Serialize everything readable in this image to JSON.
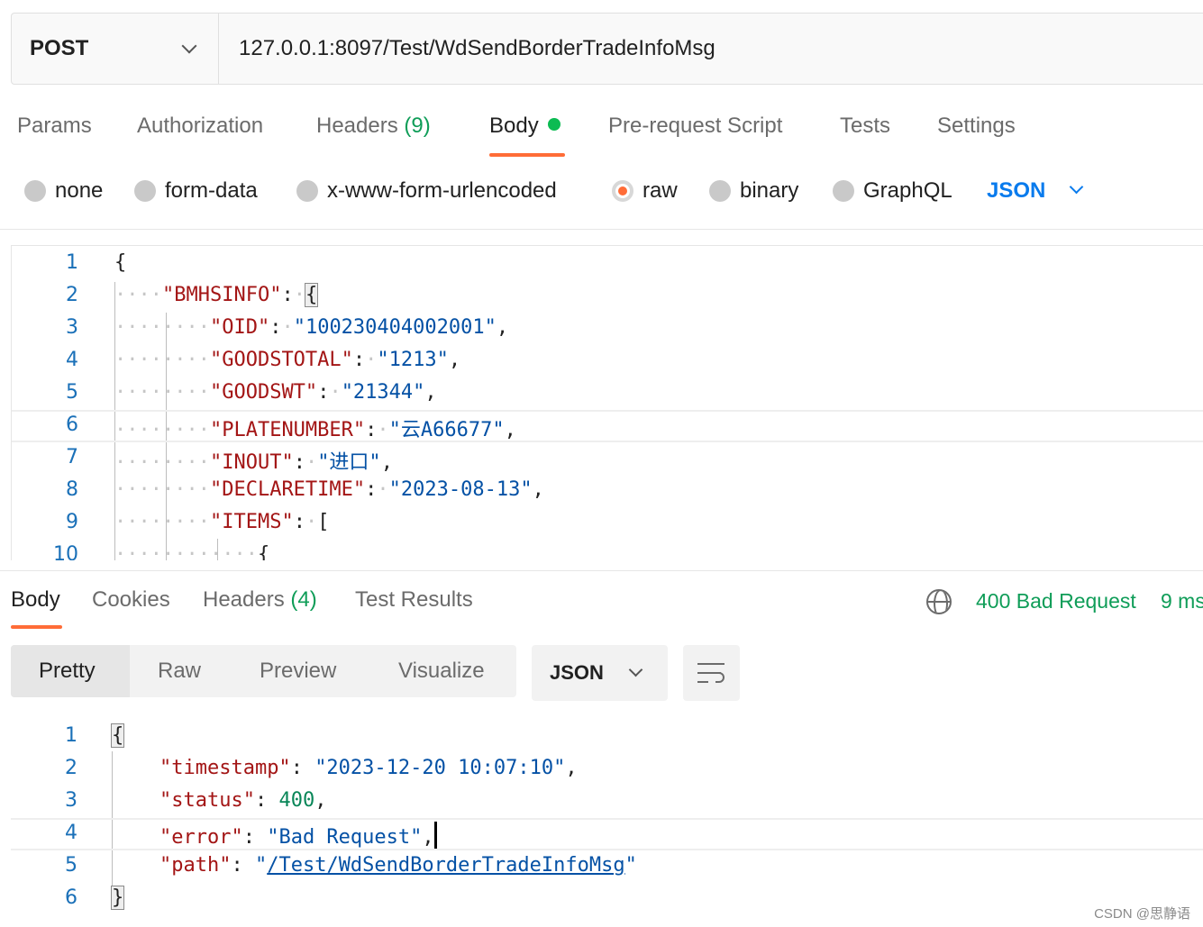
{
  "request": {
    "method": "POST",
    "url": "127.0.0.1:8097/Test/WdSendBorderTradeInfoMsg"
  },
  "request_tabs": [
    {
      "label": "Params"
    },
    {
      "label": "Authorization"
    },
    {
      "label": "Headers",
      "count": "(9)"
    },
    {
      "label": "Body",
      "active": true
    },
    {
      "label": "Pre-request Script"
    },
    {
      "label": "Tests"
    },
    {
      "label": "Settings"
    }
  ],
  "body_types": [
    {
      "label": "none"
    },
    {
      "label": "form-data"
    },
    {
      "label": "x-www-form-urlencoded"
    },
    {
      "label": "raw",
      "selected": true
    },
    {
      "label": "binary"
    },
    {
      "label": "GraphQL"
    }
  ],
  "body_format": "JSON",
  "request_body": {
    "line_numbers": [
      "1",
      "2",
      "3",
      "4",
      "5",
      "6",
      "7",
      "8",
      "9",
      "10"
    ],
    "open_brace": "{",
    "root_key": "\"BMHSINFO\"",
    "fields": [
      {
        "key": "\"OID\"",
        "value": "\"100230404002001\""
      },
      {
        "key": "\"GOODSTOTAL\"",
        "value": "\"1213\""
      },
      {
        "key": "\"GOODSWT\"",
        "value": "\"21344\""
      },
      {
        "key": "\"PLATENUMBER\"",
        "value": "\"云A66677\""
      },
      {
        "key": "\"INOUT\"",
        "value": "\"进口\""
      },
      {
        "key": "\"DECLARETIME\"",
        "value": "\"2023-08-13\""
      }
    ],
    "items_key": "\"ITEMS\"",
    "items_open": "["
  },
  "response_tabs": [
    {
      "label": "Body",
      "active": true
    },
    {
      "label": "Cookies"
    },
    {
      "label": "Headers",
      "count": "(4)"
    },
    {
      "label": "Test Results"
    }
  ],
  "response_status": "400 Bad Request",
  "response_time": "9 ms",
  "response_views": [
    "Pretty",
    "Raw",
    "Preview",
    "Visualize"
  ],
  "response_format": "JSON",
  "response_body": {
    "line_numbers": [
      "1",
      "2",
      "3",
      "4",
      "5",
      "6"
    ],
    "timestamp_key": "\"timestamp\"",
    "timestamp_value": "\"2023-12-20 10:07:10\"",
    "status_key": "\"status\"",
    "status_value": "400",
    "error_key": "\"error\"",
    "error_value": "\"Bad Request\"",
    "path_key": "\"path\"",
    "path_value": "/Test/WdSendBorderTradeInfoMsg"
  },
  "watermark": "CSDN @思静语",
  "colors": {
    "accent": "#ff6c37",
    "status_green": "#0f9d58",
    "link_blue": "#097bed"
  },
  "icons": [
    "chevron-down-icon",
    "globe-icon",
    "wrap-lines-icon"
  ]
}
